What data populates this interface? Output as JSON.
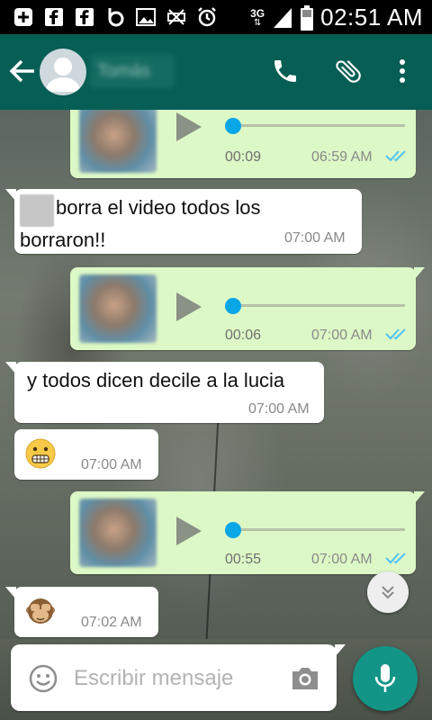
{
  "status_bar": {
    "time": "02:51 AM",
    "network": "3G"
  },
  "app_bar": {
    "contact_name": "Tomás"
  },
  "messages": [
    {
      "type": "voice",
      "direction": "out",
      "duration": "00:09",
      "time": "06:59 AM",
      "status": "read"
    },
    {
      "type": "text",
      "direction": "in",
      "text": "borra el video todos los borraron!!",
      "time": "07:00 AM"
    },
    {
      "type": "voice",
      "direction": "out",
      "duration": "00:06",
      "time": "07:00 AM",
      "status": "read"
    },
    {
      "type": "text",
      "direction": "in",
      "text": "y todos dicen decile a la lucia",
      "time": "07:00 AM"
    },
    {
      "type": "emoji",
      "direction": "in",
      "emoji": "grimacing-face",
      "time": "07:00 AM"
    },
    {
      "type": "voice",
      "direction": "out",
      "duration": "00:55",
      "time": "07:00 AM",
      "status": "read"
    },
    {
      "type": "emoji",
      "direction": "in",
      "emoji": "see-no-evil-monkey",
      "time": "07:02 AM"
    }
  ],
  "input": {
    "placeholder": "Escribir mensaje"
  },
  "colors": {
    "header": "#075e54",
    "outgoing": "#dcf8c6",
    "incoming": "#ffffff",
    "read_ticks": "#4fc3f7",
    "mic": "#129587"
  }
}
